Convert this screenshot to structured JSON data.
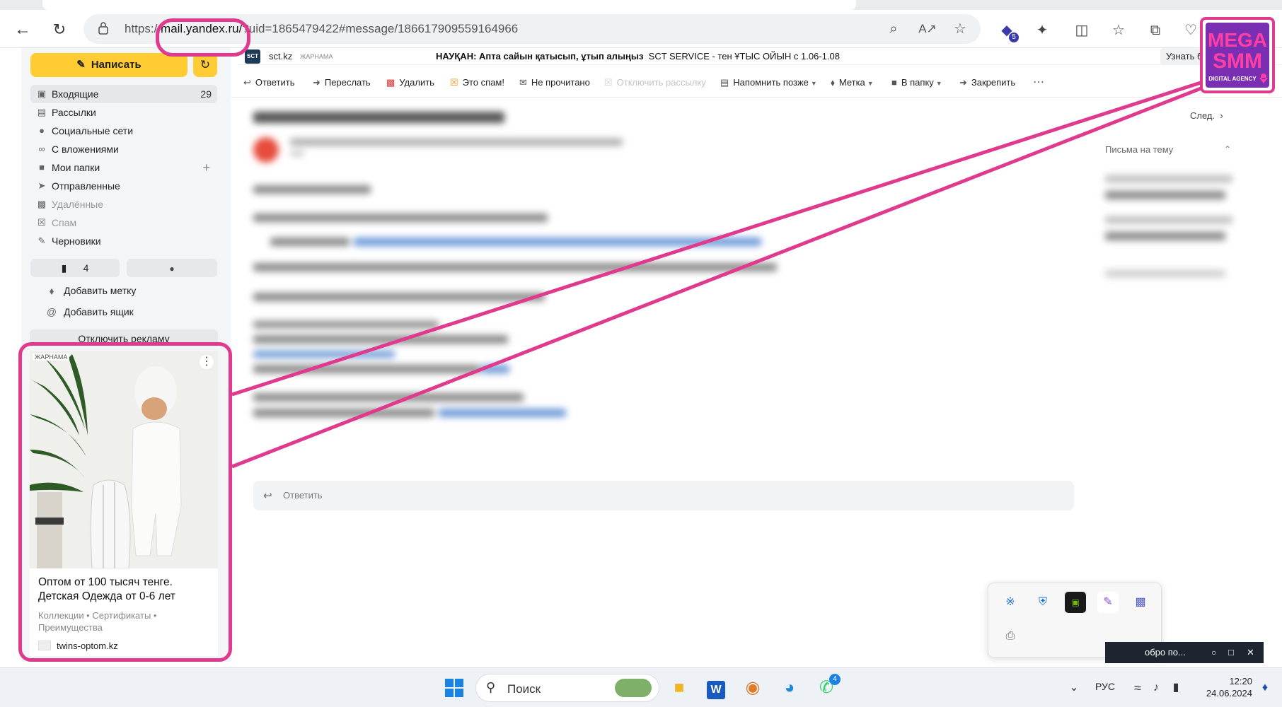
{
  "browser": {
    "url_prefix": "https://",
    "url_host": "mail.yandex.ru/",
    "url_rest": "?uid=1865479422#message/186617909559164966",
    "extension_badge": "5"
  },
  "sidebar": {
    "compose_label": "Написать",
    "folders": [
      {
        "label": "Входящие",
        "count": "29"
      },
      {
        "label": "Рассылки"
      },
      {
        "label": "Социальные сети"
      },
      {
        "label": "С вложениями"
      },
      {
        "label": "Мои папки"
      },
      {
        "label": "Отправленные"
      },
      {
        "label": "Удалённые"
      },
      {
        "label": "Спам"
      },
      {
        "label": "Черновики"
      }
    ],
    "bookmarks_count": "4",
    "add_label": "Добавить метку",
    "add_mailbox": "Добавить ящик",
    "disable_ads": "Отключить рекламу"
  },
  "ad": {
    "label": "ЖАРНАМА",
    "title": "Оптом от 100 тысяч тенге. Детская Одежда от 0-6 лет",
    "subtitle": "Коллекции • Сертификаты • Преимущества",
    "domain": "twins-optom.kz"
  },
  "top_ad": {
    "site": "sct.kz",
    "tag": "ЖАРНАМА",
    "headline": "НАУҚАН: Апта сайын қатысып, ұтып алыңыз",
    "text": "SCT SERVICE - тен ҰТЫС ОЙЫН с 1.06-1.08",
    "more": "Узнать б"
  },
  "actions": [
    {
      "label": "Ответить",
      "icon": "reply-icon"
    },
    {
      "label": "Переслать",
      "icon": "forward-icon"
    },
    {
      "label": "Удалить",
      "icon": "trash-icon"
    },
    {
      "label": "Это спам!",
      "icon": "spam-icon"
    },
    {
      "label": "Не прочитано",
      "icon": "envelope-icon"
    },
    {
      "label": "Отключить рассылку",
      "icon": "unsubscribe-icon"
    },
    {
      "label": "Напомнить позже",
      "icon": "reminder-icon"
    },
    {
      "label": "Метка",
      "icon": "tag-icon"
    },
    {
      "label": "В папку",
      "icon": "folder-icon"
    },
    {
      "label": "Закрепить",
      "icon": "pin-icon"
    }
  ],
  "message": {
    "next_label": "След.",
    "thread_label": "Письма на тему",
    "reply_placeholder": "Ответить"
  },
  "notification": {
    "text": "обро по..."
  },
  "taskbar": {
    "search": "Поиск",
    "lang": "РУС",
    "time": "12:20",
    "date": "24.06.2024",
    "whatsapp_badge": "4"
  },
  "overlay": {
    "logo_line1": "MEGA",
    "logo_line2": "SMM",
    "logo_tagline": "DIGITAL AGENCY",
    "accent": "#e03a8e",
    "brand": "#7a2fb3"
  }
}
